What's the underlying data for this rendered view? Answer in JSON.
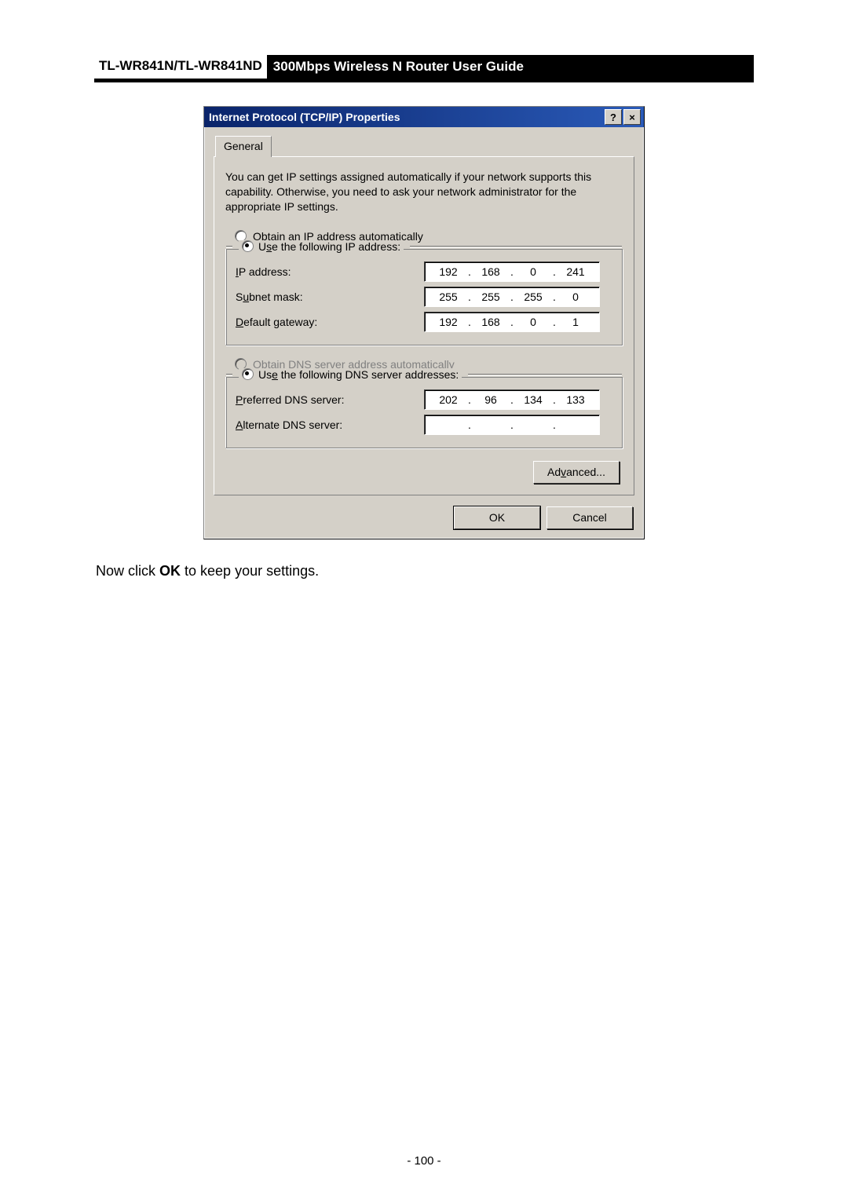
{
  "header": {
    "left": "TL-WR841N/TL-WR841ND",
    "right": "300Mbps Wireless N Router User Guide"
  },
  "dialog": {
    "title": "Internet Protocol (TCP/IP) Properties",
    "help_label": "?",
    "close_label": "×",
    "tab_general": "General",
    "description": "You can get IP settings assigned automatically if your network supports this capability. Otherwise, you need to ask your network administrator for the appropriate IP settings.",
    "radio_obtain_ip": "btain an IP address automatically",
    "radio_use_ip": "e the following IP address:",
    "label_ip": "P address:",
    "label_subnet": "bnet mask:",
    "label_gateway": "efault gateway:",
    "ip_address": {
      "a": "192",
      "b": "168",
      "c": "0",
      "d": "241"
    },
    "subnet": {
      "a": "255",
      "b": "255",
      "c": "255",
      "d": "0"
    },
    "gateway": {
      "a": "192",
      "b": "168",
      "c": "0",
      "d": "1"
    },
    "radio_obtain_dns": "tain DNS server address automatically",
    "radio_use_dns": " the following DNS server addresses:",
    "label_pref_dns": "referred DNS server:",
    "label_alt_dns": "lternate DNS server:",
    "dns_pref": {
      "a": "202",
      "b": "96",
      "c": "134",
      "d": "133"
    },
    "dns_alt": {
      "a": "",
      "b": "",
      "c": "",
      "d": ""
    },
    "btn_advanced": "anced...",
    "btn_ok": "OK",
    "btn_cancel": "Cancel"
  },
  "caption_pre": "Now click ",
  "caption_bold": "OK",
  "caption_post": " to keep your settings.",
  "page_number": "- 100 -"
}
